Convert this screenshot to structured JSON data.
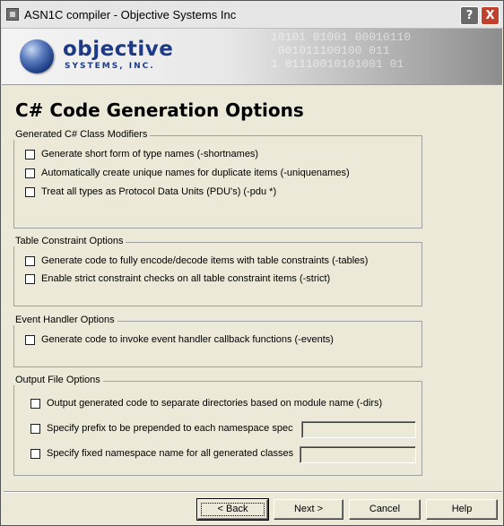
{
  "window": {
    "title": "ASN1C compiler - Objective Systems Inc",
    "help_glyph": "?",
    "close_glyph": "X"
  },
  "banner": {
    "logo_word": "objective",
    "logo_sub": "SYSTEMS, INC.",
    "bg_digits": "10101 01001 00010110\n 001011100100 011\n1 01110010101001 01"
  },
  "page": {
    "title": "C# Code Generation Options"
  },
  "groups": {
    "class_modifiers": {
      "legend": "Generated C# Class Modifiers",
      "options": [
        {
          "label": "Generate short form of type names (-shortnames)",
          "checked": false
        },
        {
          "label": "Automatically create unique names for duplicate items (-uniquenames)",
          "checked": false
        },
        {
          "label": "Treat all types as Protocol Data Units (PDU's) (-pdu *)",
          "checked": false
        }
      ]
    },
    "table_constraint": {
      "legend": "Table Constraint Options",
      "options": [
        {
          "label": "Generate code to fully encode/decode items with table constraints (-tables)",
          "checked": false
        },
        {
          "label": "Enable strict constraint checks on all table constraint items (-strict)",
          "checked": false
        }
      ]
    },
    "event_handler": {
      "legend": "Event Handler Options",
      "options": [
        {
          "label": "Generate code to invoke event handler callback functions (-events)",
          "checked": false
        }
      ]
    },
    "output_file": {
      "legend": "Output File Options",
      "options": [
        {
          "label": "Output generated code to separate directories based on module name (-dirs)",
          "checked": false
        },
        {
          "label": "Specify prefix to be prepended to each namespace spec",
          "checked": false,
          "value": ""
        },
        {
          "label": "Specify fixed namespace name for all generated classes",
          "checked": false,
          "value": ""
        }
      ]
    }
  },
  "buttons": {
    "back": "< Back",
    "next": "Next >",
    "cancel": "Cancel",
    "help": "Help"
  },
  "colors": {
    "dialog_bg": "#ece9d8",
    "brand_blue": "#1d3a86",
    "close_red": "#c2412c"
  }
}
